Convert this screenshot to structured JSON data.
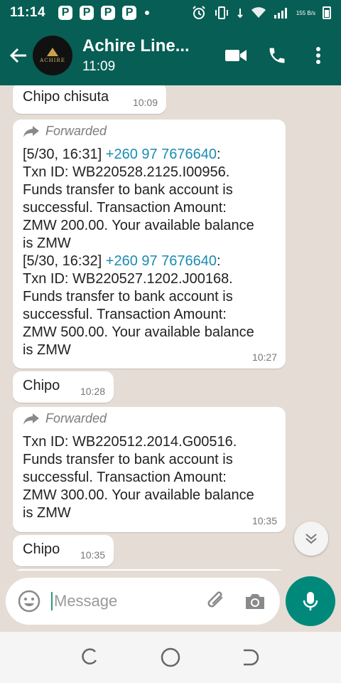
{
  "status_bar": {
    "time": "11:14",
    "notification_icons": [
      "P",
      "P",
      "P",
      "P"
    ],
    "net_speed": "155 B/s"
  },
  "header": {
    "contact_name": "Achire Line...",
    "contact_status": "11:09",
    "avatar_text": "ACHIRE"
  },
  "messages": [
    {
      "text": "Chipo chisuta",
      "time": "10:09"
    },
    {
      "forwarded_label": "Forwarded",
      "line1_prefix": "[5/30, 16:31] ",
      "line1_phone": "+260 97 7676640",
      "line1_suffix": ":",
      "body1": "Txn ID: WB220528.2125.I00956.\nFunds transfer to bank account is\nsuccessful. Transaction Amount:\nZMW 200.00. Your available balance\nis ZMW",
      "line2_prefix": "[5/30, 16:32] ",
      "line2_phone": "+260 97 7676640",
      "line2_suffix": ":",
      "body2": "Txn ID: WB220527.1202.J00168.\nFunds transfer to bank account is\nsuccessful. Transaction Amount:\nZMW 500.00. Your available balance\nis ZMW",
      "time": "10:27"
    },
    {
      "text": "Chipo",
      "time": "10:28"
    },
    {
      "forwarded_label": "Forwarded",
      "body": "Txn ID: WB220512.2014.G00516.\nFunds transfer to bank account is\nsuccessful. Transaction Amount:\nZMW 300.00. Your available balance\nis ZMW",
      "time": "10:35"
    },
    {
      "text": "Chipo",
      "time": "10:35"
    }
  ],
  "composer": {
    "placeholder": "Message"
  },
  "colors": {
    "header": "#075e54",
    "accent": "#00897b",
    "link": "#1b8bb3",
    "chat_bg": "#e5ddd5"
  }
}
